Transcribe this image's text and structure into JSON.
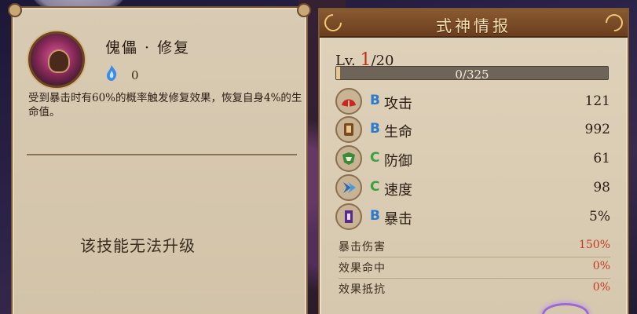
{
  "skill": {
    "name": "傀儡 · 修复",
    "orb_icon": "blue-flame-orb",
    "orb_count": "0",
    "description": "受到暴击时有60%的概率触发修复效果，恢复自身4%的生命值。",
    "no_upgrade_text": "该技能无法升级"
  },
  "info": {
    "title": "式神情报",
    "level_prefix": "Lv.",
    "level_current": "1",
    "level_max": "/20",
    "exp_text": "0/325",
    "exp_progress": 0.0,
    "stats": [
      {
        "icon": "fan-icon",
        "grade": "B",
        "name": "攻击",
        "value": "121"
      },
      {
        "icon": "scroll-icon",
        "grade": "B",
        "name": "生命",
        "value": "992"
      },
      {
        "icon": "shield-icon",
        "grade": "C",
        "name": "防御",
        "value": "61"
      },
      {
        "icon": "chevron-icon",
        "grade": "C",
        "name": "速度",
        "value": "98"
      },
      {
        "icon": "banner-icon",
        "grade": "B",
        "name": "暴击",
        "value": "5%"
      }
    ],
    "substats": [
      {
        "name": "暴击伤害",
        "value": "150%"
      },
      {
        "name": "效果命中",
        "value": "0%"
      },
      {
        "name": "效果抵抗",
        "value": "0%"
      }
    ]
  },
  "colors": {
    "accent_red": "#c03018",
    "grade_b": "#2a7ad0",
    "grade_c": "#3aa040",
    "panel": "#dfd2ba"
  }
}
